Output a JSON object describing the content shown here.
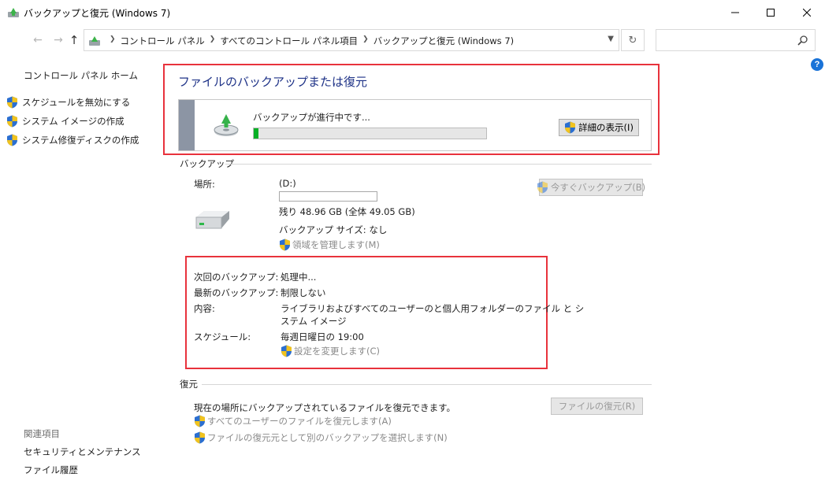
{
  "window": {
    "title": "バックアップと復元 (Windows 7)"
  },
  "address": {
    "crumbs": [
      "コントロール パネル",
      "すべてのコントロール パネル項目",
      "バックアップと復元 (Windows 7)"
    ],
    "search_placeholder": ""
  },
  "sidebar": {
    "home": "コントロール パネル ホーム",
    "tasks": [
      "スケジュールを無効にする",
      "システム イメージの作成",
      "システム修復ディスクの作成"
    ],
    "related_title": "関連項目",
    "related": [
      "セキュリティとメンテナンス",
      "ファイル履歴"
    ]
  },
  "main": {
    "title": "ファイルのバックアップまたは復元",
    "progress": {
      "label": "バックアップが進行中です...",
      "percent": 2,
      "details_button": "詳細の表示(I)"
    },
    "backup": {
      "heading": "バックアップ",
      "location_label": "場所:",
      "location_value": "(D:)",
      "space_used_fraction": 0.0,
      "free_space": "残り 48.96 GB (全体 49.05 GB)",
      "backup_size": "バックアップ サイズ: なし",
      "manage_space_link": "領域を管理します(M)",
      "backup_now_button": "今すぐバックアップ(B)",
      "next_backup_label": "次回のバックアップ:",
      "next_backup_value": "処理中...",
      "last_backup_label": "最新のバックアップ:",
      "last_backup_value": "制限しない",
      "contents_label": "内容:",
      "contents_value_1": "ライブラリおよびすべてのユーザーのと個人用フォルダーのファイル と シ",
      "contents_value_2": "ステム イメージ",
      "schedule_label": "スケジュール:",
      "schedule_value": "毎週日曜日の 19:00",
      "change_settings_link": "設定を変更します(C)"
    },
    "restore": {
      "heading": "復元",
      "description": "現在の場所にバックアップされているファイルを復元できます。",
      "restore_files_button": "ファイルの復元(R)",
      "restore_all_users_link": "すべてのユーザーのファイルを復元します(A)",
      "select_other_link": "ファイルの復元元として別のバックアップを選択します(N)"
    }
  },
  "colors": {
    "accent_title": "#1e3287",
    "highlight": "#e8323c",
    "progress": "#06b025"
  }
}
